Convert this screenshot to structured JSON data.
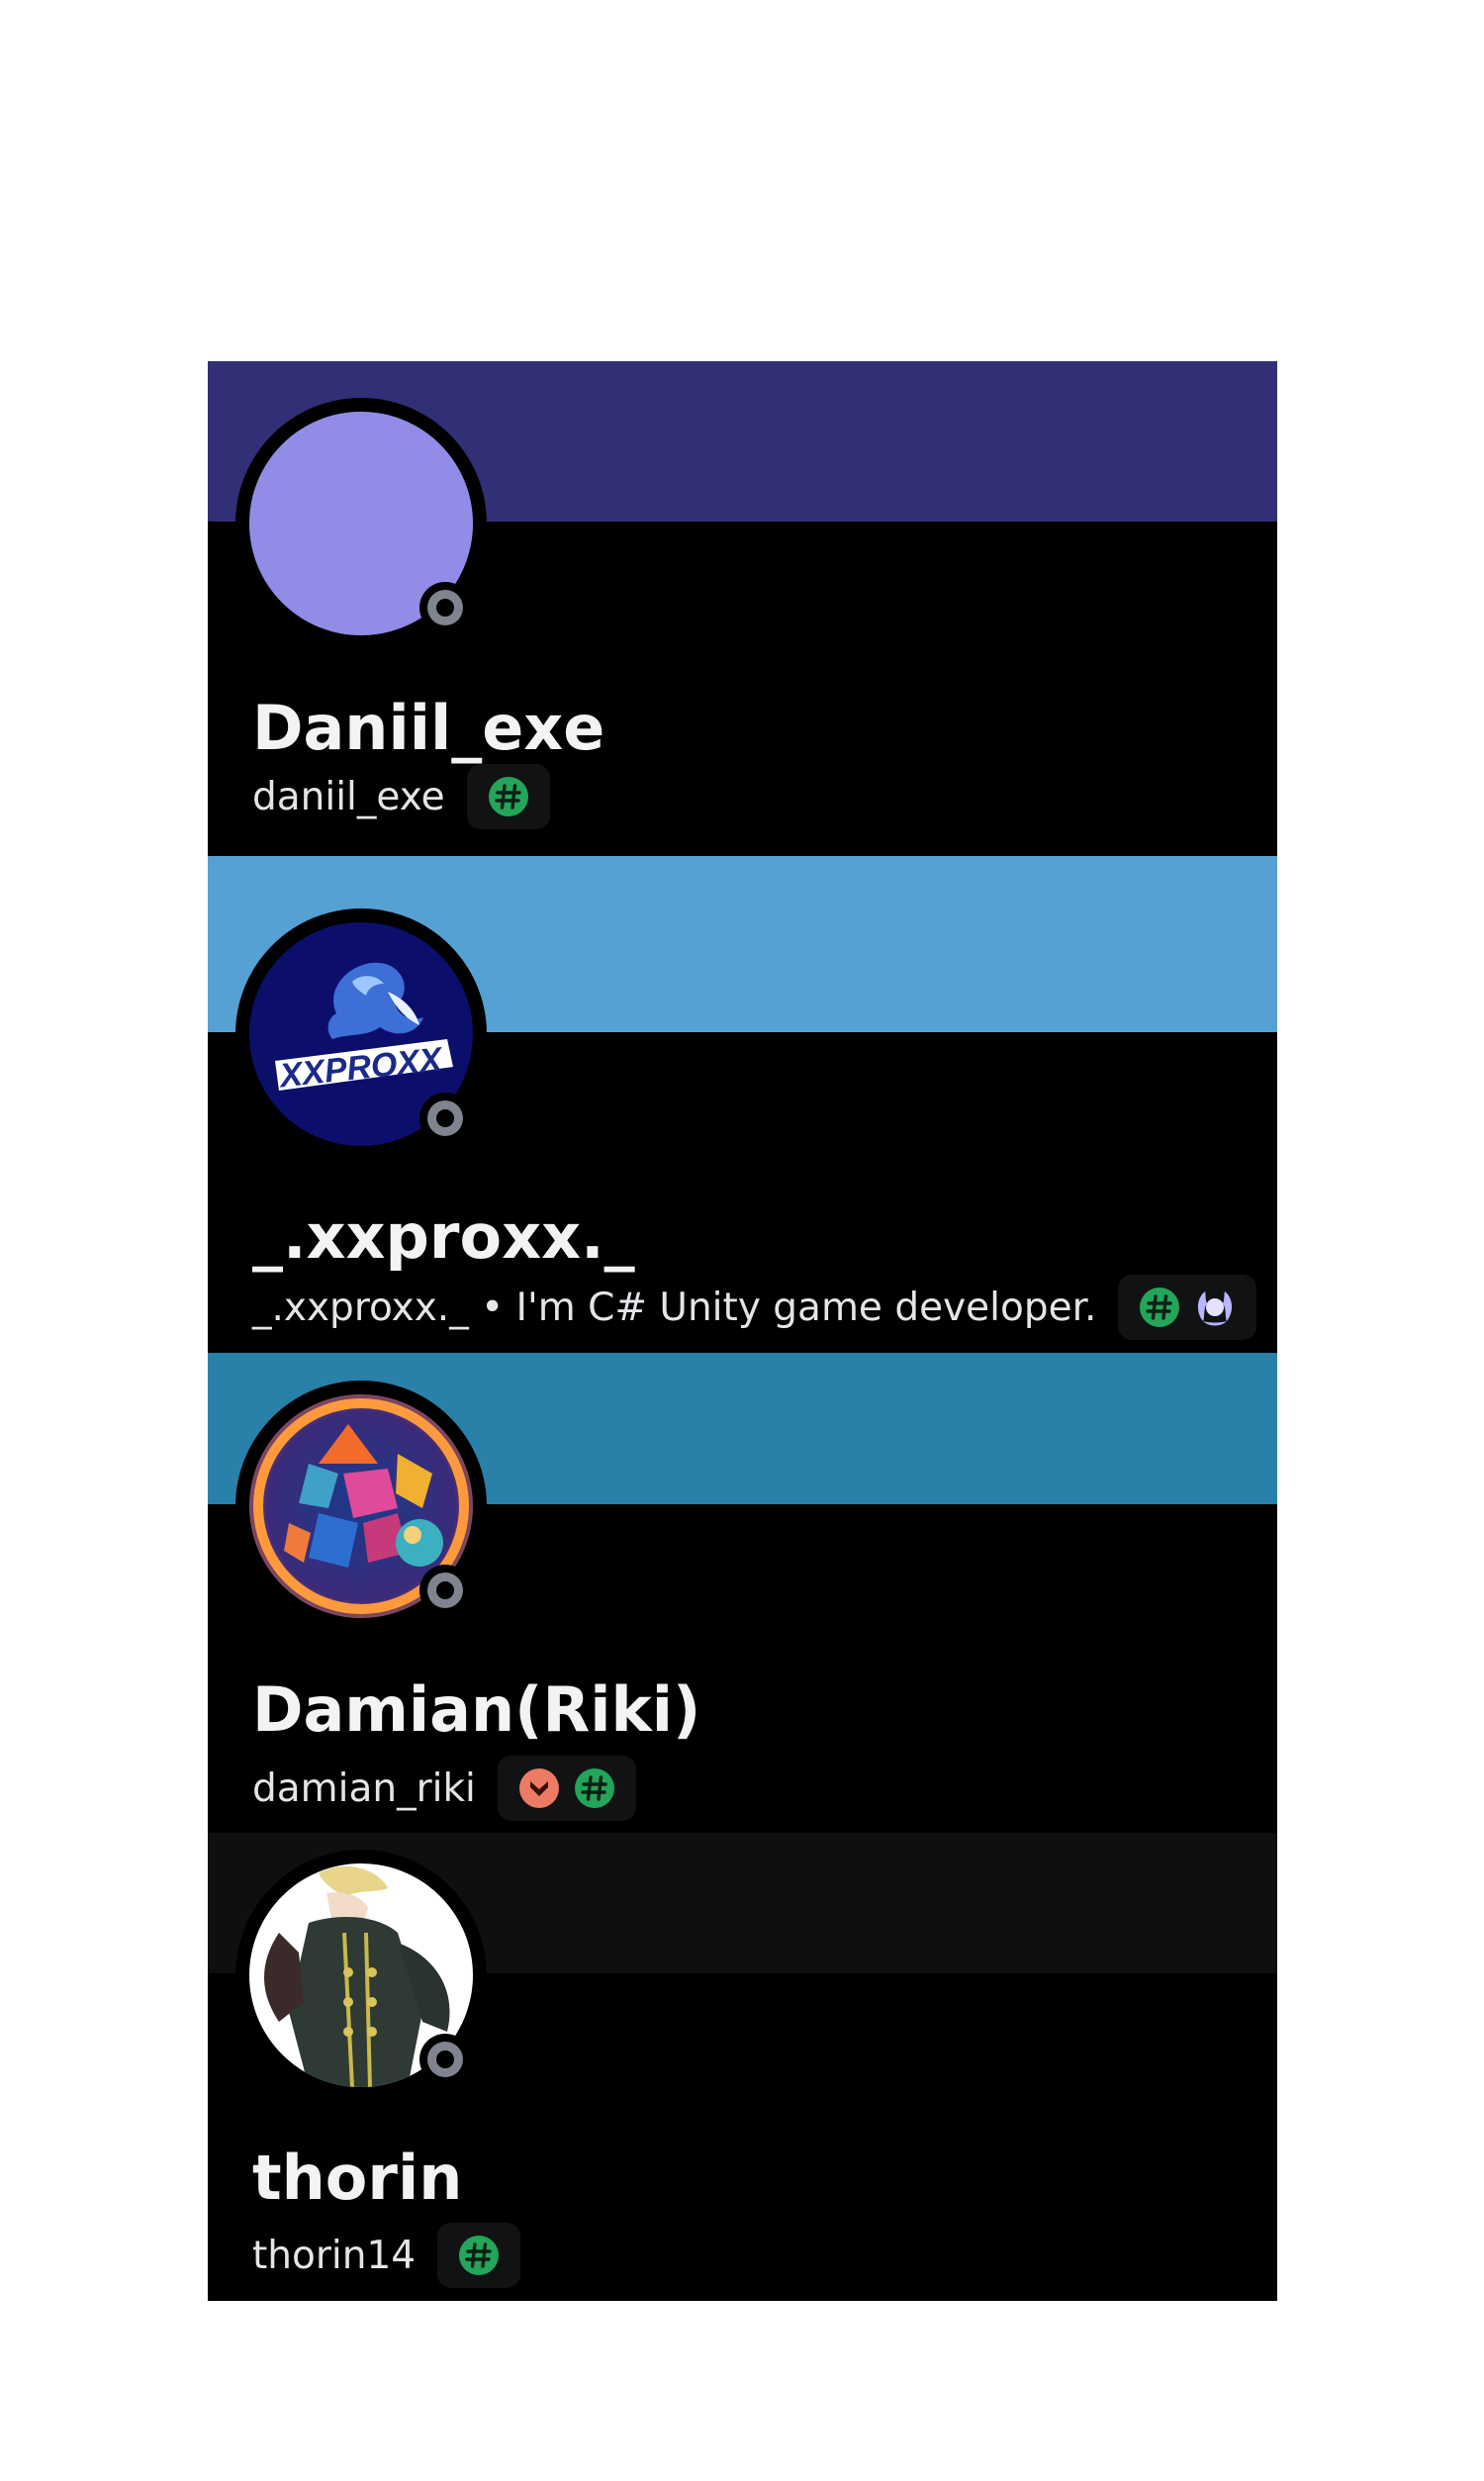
{
  "members": [
    {
      "display_name": "Daniil_exe",
      "username": "daniil_exe",
      "banner_color": "#312f75",
      "status": "offline",
      "avatar": "noise-texture-avatar",
      "badges": [
        "active-developer-badge"
      ]
    },
    {
      "display_name": "_.xxproxx._",
      "username": "_.xxproxx._ • I'm C# Unity game developer.",
      "banner_color": "#56a1d3",
      "status": "offline",
      "avatar": "xxproxx-dragon-logo-avatar",
      "avatar_text": "XXPROXX",
      "badges": [
        "active-developer-badge",
        "nitro-wreath-badge"
      ]
    },
    {
      "display_name": "Damian(Riki)",
      "username": "damian_riki",
      "banner_color": "#2980a8",
      "status": "offline",
      "avatar": "geometric-crystals-avatar",
      "badges": [
        "hypesquad-bravery-badge",
        "active-developer-badge"
      ]
    },
    {
      "display_name": "thorin",
      "username": "thorin14",
      "banner_color": "#0f0f0f",
      "status": "offline",
      "avatar": "anime-character-avatar",
      "badges": [
        "active-developer-badge"
      ]
    }
  ],
  "colors": {
    "card_background": "#000000",
    "badge_background": "#111214",
    "status_offline": "#80848e",
    "active_developer_green": "#23a55a",
    "hypesquad_red": "#ed7b63",
    "nitro_purple": "#b9b5ff"
  }
}
